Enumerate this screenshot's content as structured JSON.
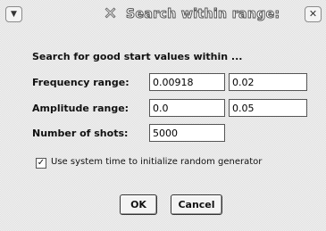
{
  "window": {
    "title": "Search within range:",
    "title_icon": "x-logo",
    "menu_icon": "chevron-down-icon",
    "close_icon": "close-icon"
  },
  "form": {
    "heading": "Search for good start values within ...",
    "frequency": {
      "label": "Frequency range:",
      "min": "0.00918",
      "max": "0.02"
    },
    "amplitude": {
      "label": "Amplitude range:",
      "min": "0.0",
      "max": "0.05"
    },
    "shots": {
      "label": "Number of shots:",
      "value": "5000"
    },
    "use_system_time": {
      "checked": true,
      "label": "Use system time to initialize random generator"
    }
  },
  "buttons": {
    "ok": "OK",
    "cancel": "Cancel"
  }
}
